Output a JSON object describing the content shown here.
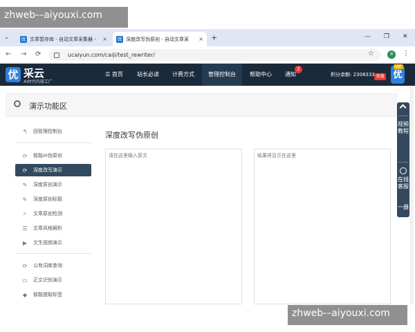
{
  "browser": {
    "tabs": [
      {
        "label": "文章暂存库 - 自动文章采集器 -",
        "active": false
      },
      {
        "label": "深度改写伪原创 - 自动文章采",
        "active": true
      }
    ],
    "menu_glyph": "⌄",
    "close_glyph": "×",
    "new_tab_glyph": "+",
    "window_controls": [
      "—",
      "❐",
      "✕"
    ],
    "nav": {
      "back": "←",
      "forward": "→",
      "reload": "⟳"
    },
    "url": "ucaiyun.com/caiji/test_rewriter/",
    "bookmark_glyph": "☆",
    "profile_letter": "Я",
    "more_glyph": "⋮",
    "tab_favicon": "优"
  },
  "header": {
    "logo_char": "优",
    "logo_name": "采云",
    "logo_sub": "AI时代内容工厂",
    "nav_items": [
      {
        "label": "☰ 首页",
        "active": false
      },
      {
        "label": "站长必读",
        "active": false
      },
      {
        "label": "计费方式",
        "active": false
      },
      {
        "label": "管理控制台",
        "active": true
      },
      {
        "label": "帮助中心",
        "active": false
      },
      {
        "label": "通知",
        "active": false
      }
    ],
    "notify_count": "2",
    "points_text": "积分余额: 2308333",
    "recharge": "充值",
    "vip_char": "优",
    "vip_label": "VIP"
  },
  "area": {
    "title": "演示功能区"
  },
  "sidebar": {
    "back_label": "回管理控制台",
    "back_glyph": "↰",
    "items": [
      {
        "label": "智能AI伪原创",
        "glyph": "⟳",
        "active": false
      },
      {
        "label": "深度改写演示",
        "glyph": "⟳",
        "active": true
      },
      {
        "label": "深度原创演示",
        "glyph": "✎",
        "active": false
      },
      {
        "label": "深度原创标题",
        "glyph": "✎",
        "active": false
      },
      {
        "label": "文章原创检测",
        "glyph": "⌕",
        "active": false
      },
      {
        "label": "文章风格解析",
        "glyph": "☰",
        "active": false
      },
      {
        "label": "文生视频演示",
        "glyph": "▶",
        "active": false
      },
      {
        "label": "公有词库查询",
        "glyph": "⟳",
        "active": false
      },
      {
        "label": "正文识别演示",
        "glyph": "▭",
        "active": false
      },
      {
        "label": "智能提取标签",
        "glyph": "◆",
        "active": false
      }
    ]
  },
  "main": {
    "title": "深度改写伪原创",
    "input_placeholder": "请在这里输入原文",
    "output_placeholder": "结果将显示在这里"
  },
  "float_panel": {
    "video_tutorial": "视频教程",
    "online_service": "在线客服",
    "trailing": "一器"
  },
  "watermark": "zhweb-–aiyouxi.com"
}
